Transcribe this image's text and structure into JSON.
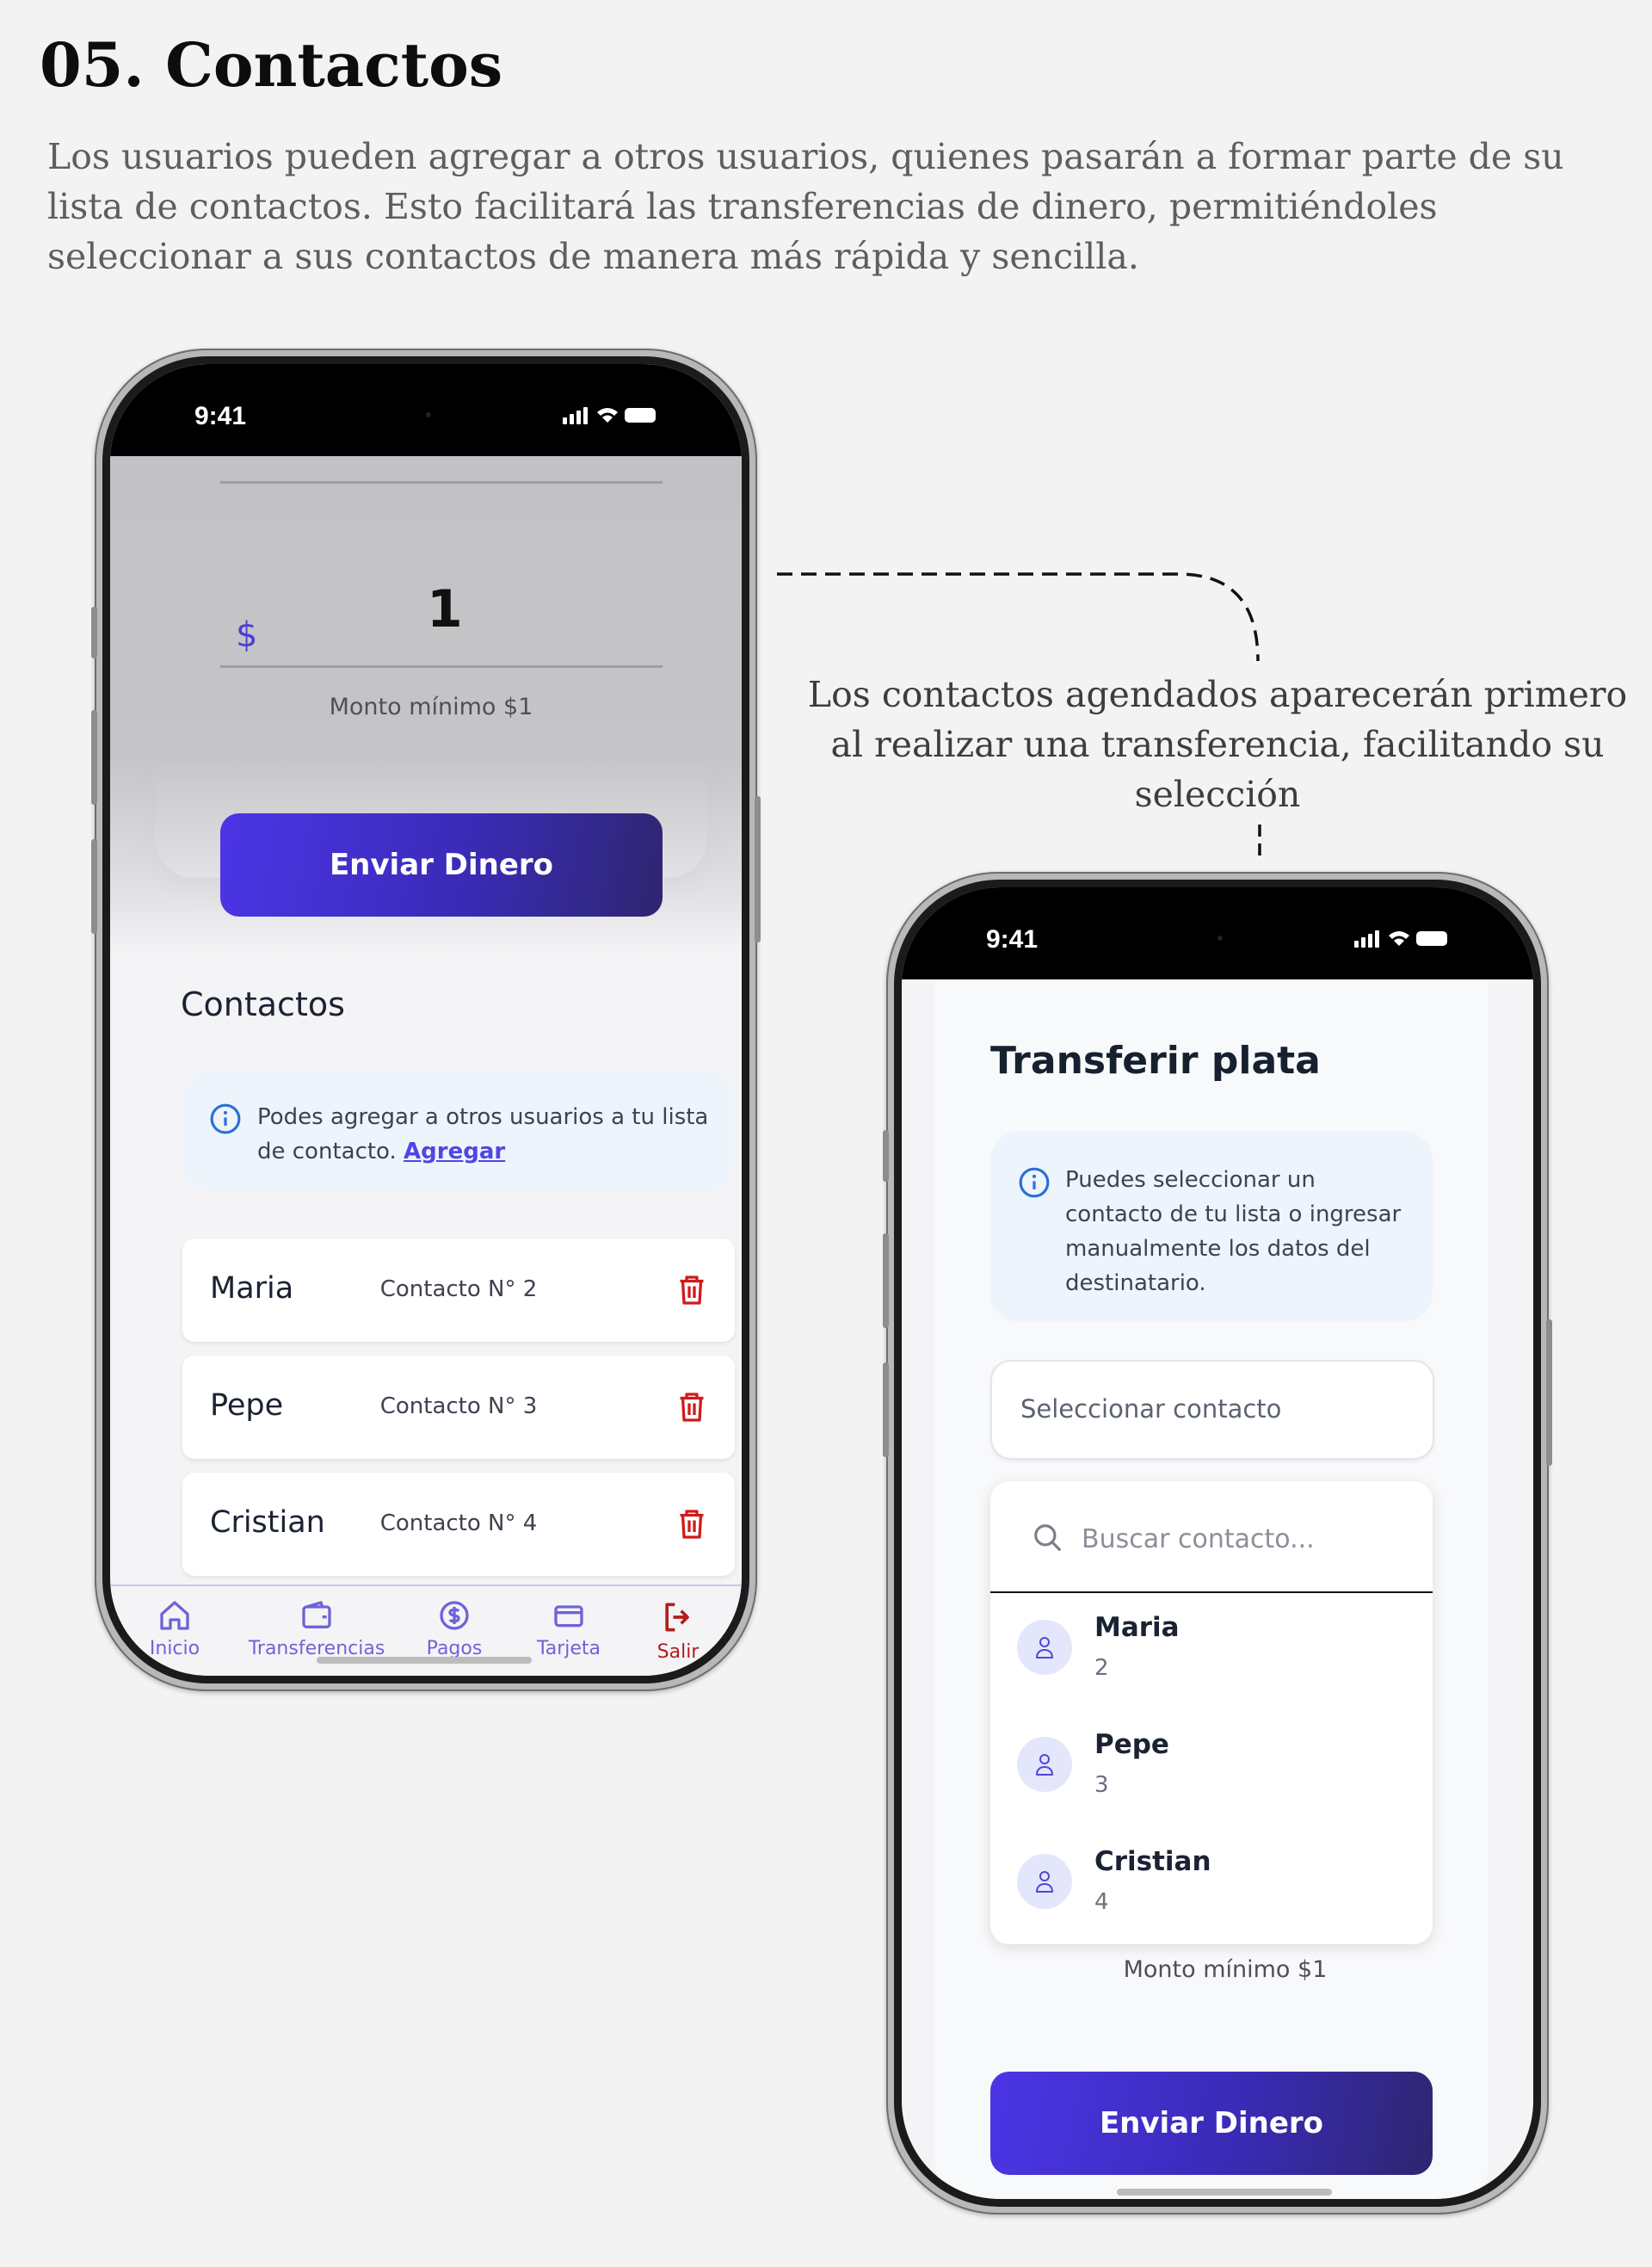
{
  "heading": {
    "title": "05. Contactos"
  },
  "intro": "Los usuarios pueden agregar a otros usuarios, quienes pasarán a formar parte de su lista de contactos. Esto facilitará las transferencias de dinero, permitiéndoles seleccionar a sus contactos de manera más rápida y sencilla.",
  "callout": "Los contactos agendados aparecerán primero al realizar una transferencia, facilitando su selección",
  "colors": {
    "accent": "#4f46e5",
    "button_gradient_start": "#4c35e6",
    "button_gradient_end": "#2e2670",
    "danger": "#d11a1a",
    "info_bg": "#eef4fc"
  },
  "phone1": {
    "status_time": "9:41",
    "amount_currency": "$",
    "amount_value": "1",
    "min_amount": "Monto mínimo $1",
    "send_button": "Enviar Dinero",
    "contacts_title": "Contactos",
    "info_text": "Podes agregar a otros usuarios a tu lista de contacto.",
    "info_link": "Agregar",
    "contacts": [
      {
        "name": "Maria",
        "number": "Contacto N° 2"
      },
      {
        "name": "Pepe",
        "number": "Contacto N° 3"
      },
      {
        "name": "Cristian",
        "number": "Contacto N° 4"
      }
    ],
    "nav": [
      {
        "label": "Inicio",
        "icon": "home-icon"
      },
      {
        "label": "Transferencias",
        "icon": "wallet-icon"
      },
      {
        "label": "Pagos",
        "icon": "dollar-circle-icon"
      },
      {
        "label": "Tarjeta",
        "icon": "credit-card-icon"
      },
      {
        "label": "Salir",
        "icon": "logout-icon"
      }
    ]
  },
  "phone2": {
    "status_time": "9:41",
    "title": "Transferir plata",
    "info_text": "Puedes seleccionar un contacto de tu lista o ingresar manualmente los datos del destinatario.",
    "select_placeholder": "Seleccionar contacto",
    "search_placeholder": "Buscar contacto...",
    "contacts": [
      {
        "name": "Maria",
        "id": "2"
      },
      {
        "name": "Pepe",
        "id": "3"
      },
      {
        "name": "Cristian",
        "id": "4"
      }
    ],
    "min_amount": "Monto mínimo $1",
    "send_button": "Enviar Dinero"
  }
}
